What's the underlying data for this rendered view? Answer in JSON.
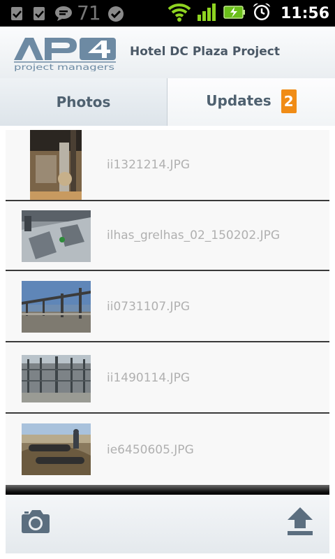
{
  "status_bar": {
    "notification_count": "71",
    "time": "11:56",
    "icons": [
      "check-icon",
      "check-icon",
      "chat-icon",
      "check-badge-icon",
      "wifi-icon",
      "signal-icon",
      "battery-charging-icon",
      "alarm-icon"
    ]
  },
  "header": {
    "logo_text": "AP4",
    "logo_tagline": "project managers",
    "title": "Hotel DC Plaza Project"
  },
  "tabs": [
    {
      "label": "Photos",
      "selected": true
    },
    {
      "label": "Updates",
      "badge": "2",
      "selected": false
    }
  ],
  "photos": [
    {
      "file_name": "ii1321214.JPG"
    },
    {
      "file_name": "ilhas_grelhas_02_150202.JPG"
    },
    {
      "file_name": "ii0731107.JPG"
    },
    {
      "file_name": "ii1490114.JPG"
    },
    {
      "file_name": "ie6450605.JPG"
    }
  ],
  "toolbar": {
    "left_icon": "camera-icon",
    "right_icon": "upload-icon"
  },
  "colors": {
    "accent_badge": "#f08c16",
    "header_text": "#4a5866",
    "logo_blue": "#6d8aa3"
  }
}
